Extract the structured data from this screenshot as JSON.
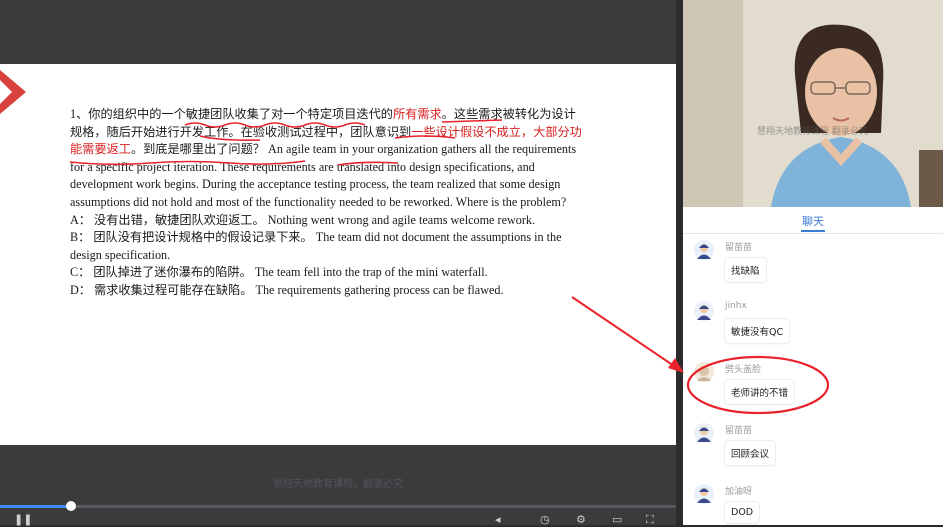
{
  "slide": {
    "question_parts": [
      {
        "text": "1、你的组织中的一个敏捷团队收集了对一个特定项目迭代的",
        "hl": false
      },
      {
        "text": "所有需求",
        "hl": true
      },
      {
        "text": "。这些需求被转化为设计规格，随后开始进行开发工作。在验收测试过程中，团队意识到",
        "hl": false
      },
      {
        "text": "一些设计假设不成立，大部分功能需要返工",
        "hl": true
      },
      {
        "text": "。到底是哪里出了问题？ An agile team in your organization gathers all the requirements for a specific project iteration. These requirements are translated into design specifications, and development work begins. During the acceptance testing process, the team realized that some design assumptions did not hold and most of the functionality needed to be reworked. Where is the problem?",
        "hl": false
      }
    ],
    "option_a": "A： 没有出错，敏捷团队欢迎返工。 Nothing went wrong and agile teams welcome rework.",
    "option_b": "B： 团队没有把设计规格中的假设记录下来。 The team did not document the assumptions in the design specification.",
    "option_c": "C： 团队掉进了迷你瀑布的陷阱。 The team fell into the trap of the mini waterfall.",
    "option_d": "D： 需求收集过程可能存在缺陷。 The requirements gathering process can be flawed."
  },
  "player": {
    "watermark": "慧翔天地教育课程，翻录必究",
    "progress": 0.105
  },
  "camera": {
    "watermark": "慧翔天地教育课程 翻录必究"
  },
  "chat": {
    "tab_label": "聊天",
    "messages": [
      {
        "user": "留苗苗",
        "text": "找缺陷",
        "avatar": "default-avatar"
      },
      {
        "user": "jinhx",
        "text": "敏捷没有QC",
        "avatar": "default-avatar"
      },
      {
        "user": "劈头盖脸",
        "text": "老师讲的不错",
        "avatar": "photo-avatar"
      },
      {
        "user": "留苗苗",
        "text": "回顾会议",
        "avatar": "default-avatar"
      },
      {
        "user": "加油呀",
        "text": "DOD",
        "avatar": "default-avatar"
      }
    ]
  },
  "colors": {
    "highlight": "#d81e1e",
    "annotation": "#e8232b",
    "accent": "#3a7bd5"
  }
}
